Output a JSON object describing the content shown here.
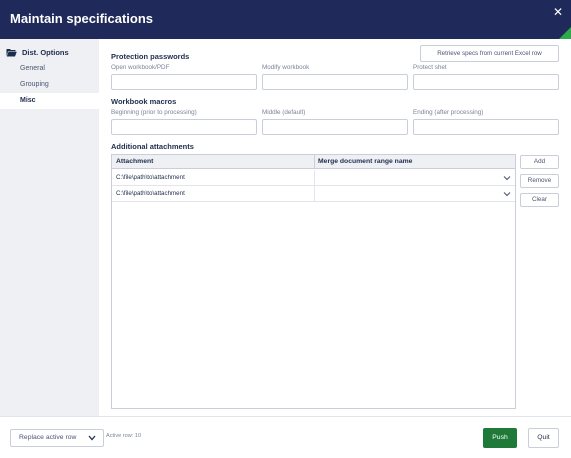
{
  "window": {
    "title": "Maintain specifications",
    "close_glyph": "✕",
    "accent_color": "#2eaa4a",
    "header_color": "#1f2a5a"
  },
  "sidebar": {
    "header": {
      "label": "Dist. Options",
      "icon": "folder-open-icon"
    },
    "items": [
      {
        "label": "General",
        "active": false
      },
      {
        "label": "Grouping",
        "active": false
      },
      {
        "label": "Misc",
        "active": true
      }
    ]
  },
  "main": {
    "retrieve_button": "Retrieve specs from current Excel row",
    "protection": {
      "title": "Protection passwords",
      "fields": [
        {
          "label": "Open workbook/PDF",
          "value": ""
        },
        {
          "label": "Modify workbook",
          "value": ""
        },
        {
          "label": "Protect shet",
          "value": ""
        }
      ]
    },
    "macros": {
      "title": "Workbook macros",
      "fields": [
        {
          "label": "Beginning (prior to processing)",
          "value": ""
        },
        {
          "label": "Middle (default)",
          "value": ""
        },
        {
          "label": "Ending (after processing)",
          "value": ""
        }
      ]
    },
    "attachments": {
      "title": "Additional attachments",
      "columns": [
        "Attachment",
        "Merge document range name"
      ],
      "rows": [
        {
          "attachment": "C:\\file\\path\\to\\attachment",
          "range": ""
        },
        {
          "attachment": "C:\\file\\path\\to\\attachment",
          "range": ""
        }
      ],
      "buttons": {
        "add": "Add",
        "remove": "Remove",
        "clear": "Clear"
      }
    }
  },
  "footer": {
    "replace_select": "Replace active row",
    "active_row": "Active row: 10",
    "push": "Push",
    "quit": "Quit",
    "push_color": "#1f7a3a"
  }
}
